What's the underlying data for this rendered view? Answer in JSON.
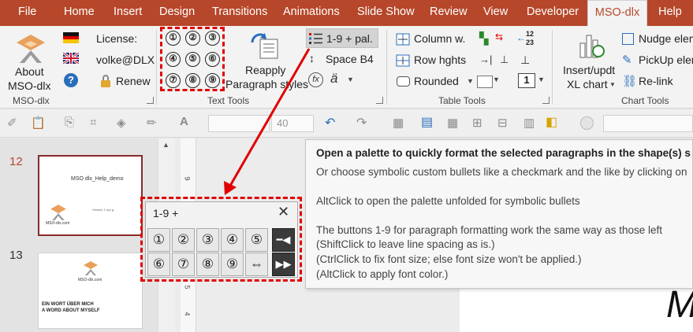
{
  "tabs": [
    "File",
    "Home",
    "Insert",
    "Design",
    "Transitions",
    "Animations",
    "Slide Show",
    "Review",
    "View",
    "Developer",
    "MSO-dlx",
    "Help"
  ],
  "ribbon": {
    "about_label": "About",
    "about_label2": "MSO-dlx",
    "license_label": "License:",
    "license_user": "volke@DLX",
    "renew_label": "Renew",
    "numbered": [
      "①",
      "②",
      "③",
      "④",
      "⑤",
      "⑥",
      "⑦",
      "⑧",
      "⑨"
    ],
    "reapply_label": "Reapply",
    "reapply_label2": "Paragraph styles",
    "palette_button": "1-9 + pal.",
    "space_b4": "Space B4",
    "fx_symbol": "fx",
    "a_umlaut": "ä",
    "column_w": "Column w.",
    "row_hghts": "Row hghts",
    "rounded": "Rounded",
    "insert_updt": "Insert/updt",
    "xl_chart": "XL chart",
    "nudge": "Nudge elem",
    "pickup": "PickUp elem",
    "relink": "Re-link",
    "table_num_top": "12",
    "table_num_bot": "23",
    "row_box_num": "1",
    "groups": {
      "msodlx": "MSO-dlx",
      "text_tools": "Text Tools",
      "table_tools": "Table Tools",
      "chart_tools": "Chart Tools"
    }
  },
  "qat": {
    "font_size": "40"
  },
  "slides": [
    {
      "number": "12",
      "title": "MSO dlx_Help_demo",
      "version": "Version 1.xyz.g",
      "logo_text": "MSO-dlx.com"
    },
    {
      "number": "13",
      "logo_text": "MSO-dlx.com",
      "heading1": "EIN WORT ÜBER MICH",
      "heading2": "A WORD ABOUT MYSELF"
    }
  ],
  "tooltip": {
    "title": "Open a palette to quickly format the selected paragraphs in the shape(s) s",
    "line1": "Or choose symbolic custom bullets like a checkmark and the like by clicking on",
    "line2": "AltClick to open the palette unfolded for symbolic bullets",
    "line3": "The buttons 1-9 for paragraph formatting work the same way as those left",
    "line4": "(ShiftClick to leave line spacing as is.)",
    "line5": "(CtrlClick to fix font size;  else font size won't be applied.)",
    "line6": "(AltClick to apply font color.)"
  },
  "palette": {
    "title": "1-9 +",
    "row1": [
      "①",
      "②",
      "③",
      "④",
      "⑤"
    ],
    "row2": [
      "⑥",
      "⑦",
      "⑧",
      "⑨",
      "⇔"
    ],
    "pin": "📌",
    "expand": "⏩"
  },
  "ruler_labels": [
    "9",
    "5",
    "4"
  ],
  "slide_big_letter": "M",
  "colors": {
    "accent": "#b7472a",
    "highlight": "#e10000"
  }
}
